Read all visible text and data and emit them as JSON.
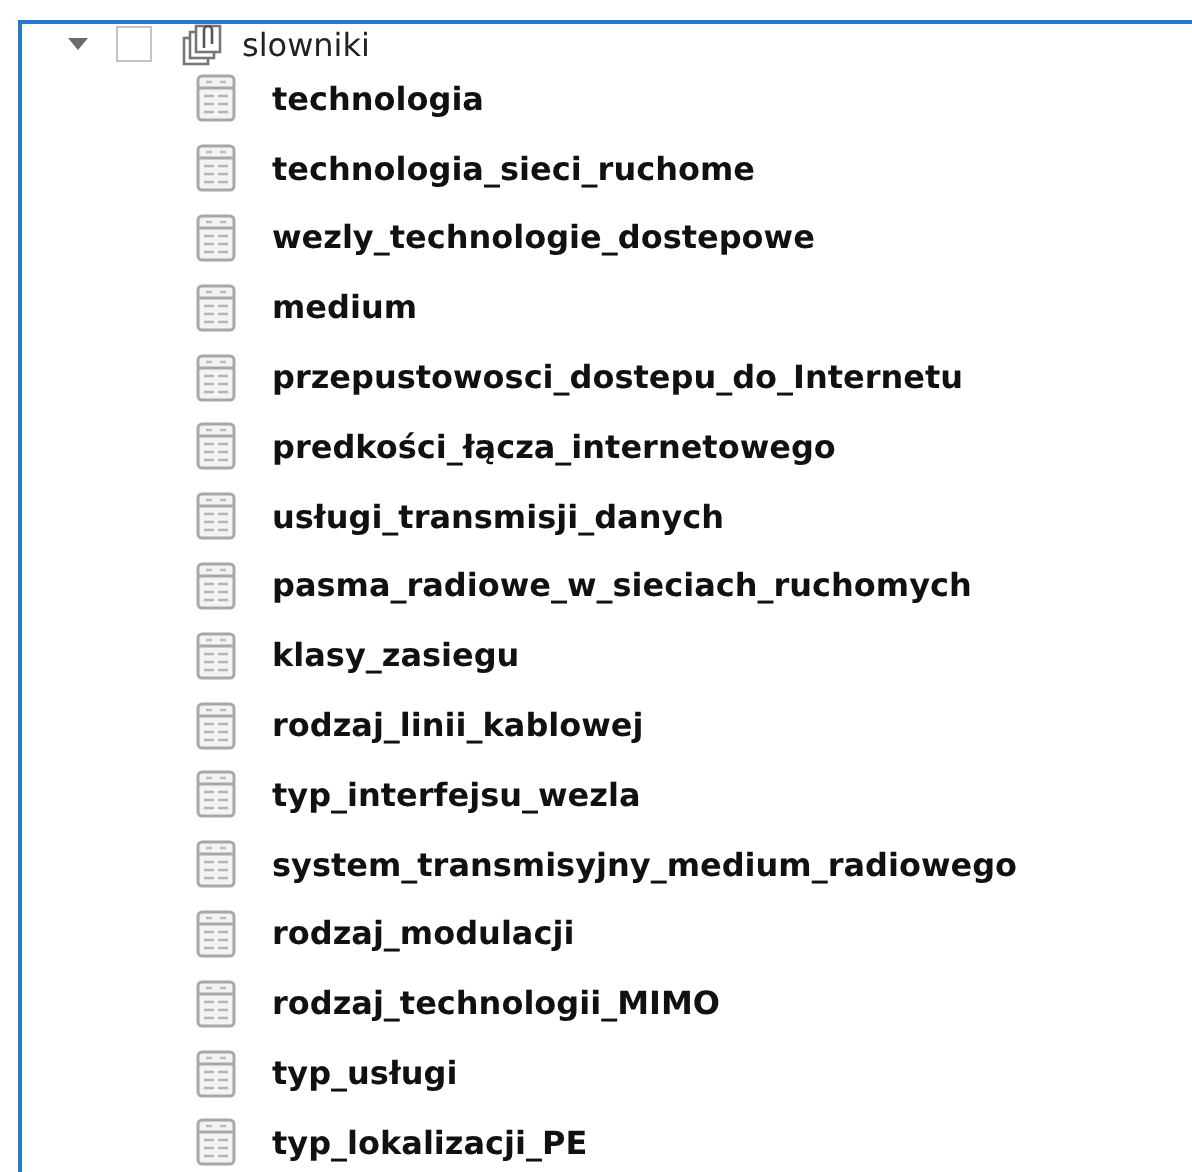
{
  "tree": {
    "name": "slowniki",
    "expanded": true,
    "checked": false,
    "children": [
      {
        "name": "technologia"
      },
      {
        "name": "technologia_sieci_ruchome"
      },
      {
        "name": "wezly_technologie_dostepowe"
      },
      {
        "name": "medium"
      },
      {
        "name": "przepustowosci_dostepu_do_Internetu"
      },
      {
        "name": "predkości_łącza_internetowego"
      },
      {
        "name": "usługi_transmisji_danych"
      },
      {
        "name": "pasma_radiowe_w_sieciach_ruchomych"
      },
      {
        "name": "klasy_zasiegu"
      },
      {
        "name": "rodzaj_linii_kablowej"
      },
      {
        "name": "typ_interfejsu_wezla"
      },
      {
        "name": "system_transmisyjny_medium_radiowego"
      },
      {
        "name": "rodzaj_modulacji"
      },
      {
        "name": "rodzaj_technologii_MIMO"
      },
      {
        "name": "typ_usługi"
      },
      {
        "name": "typ_lokalizacji_PE"
      }
    ]
  }
}
